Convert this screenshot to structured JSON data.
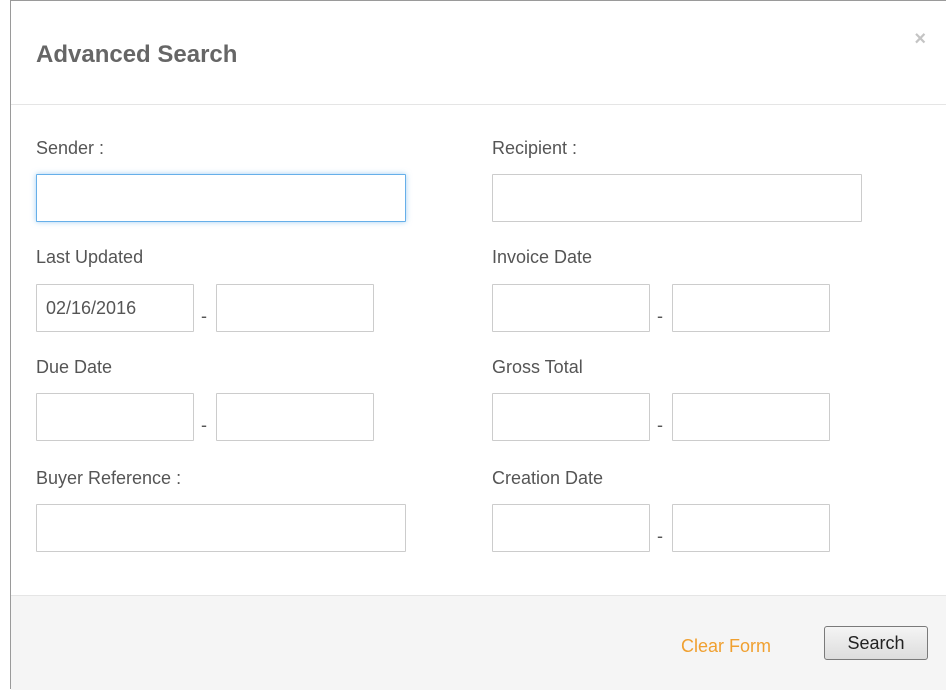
{
  "modal": {
    "title": "Advanced Search",
    "close_symbol": "×",
    "close_icon": "close-icon"
  },
  "form": {
    "sender": {
      "label": "Sender :",
      "value": ""
    },
    "recipient": {
      "label": "Recipient :",
      "value": ""
    },
    "last_updated": {
      "label": "Last Updated",
      "from": "02/16/2016",
      "to": ""
    },
    "invoice_date": {
      "label": "Invoice Date",
      "from": "",
      "to": ""
    },
    "due_date": {
      "label": "Due Date",
      "from": "",
      "to": ""
    },
    "gross_total": {
      "label": "Gross Total",
      "from": "",
      "to": ""
    },
    "buyer_reference": {
      "label": "Buyer Reference :",
      "value": ""
    },
    "creation_date": {
      "label": "Creation Date",
      "from": "",
      "to": ""
    },
    "range_separator": "-"
  },
  "footer": {
    "clear_label": "Clear Form",
    "search_label": "Search"
  },
  "colors": {
    "link": "#f0a030",
    "focus": "#66afe9",
    "title": "#666666"
  }
}
